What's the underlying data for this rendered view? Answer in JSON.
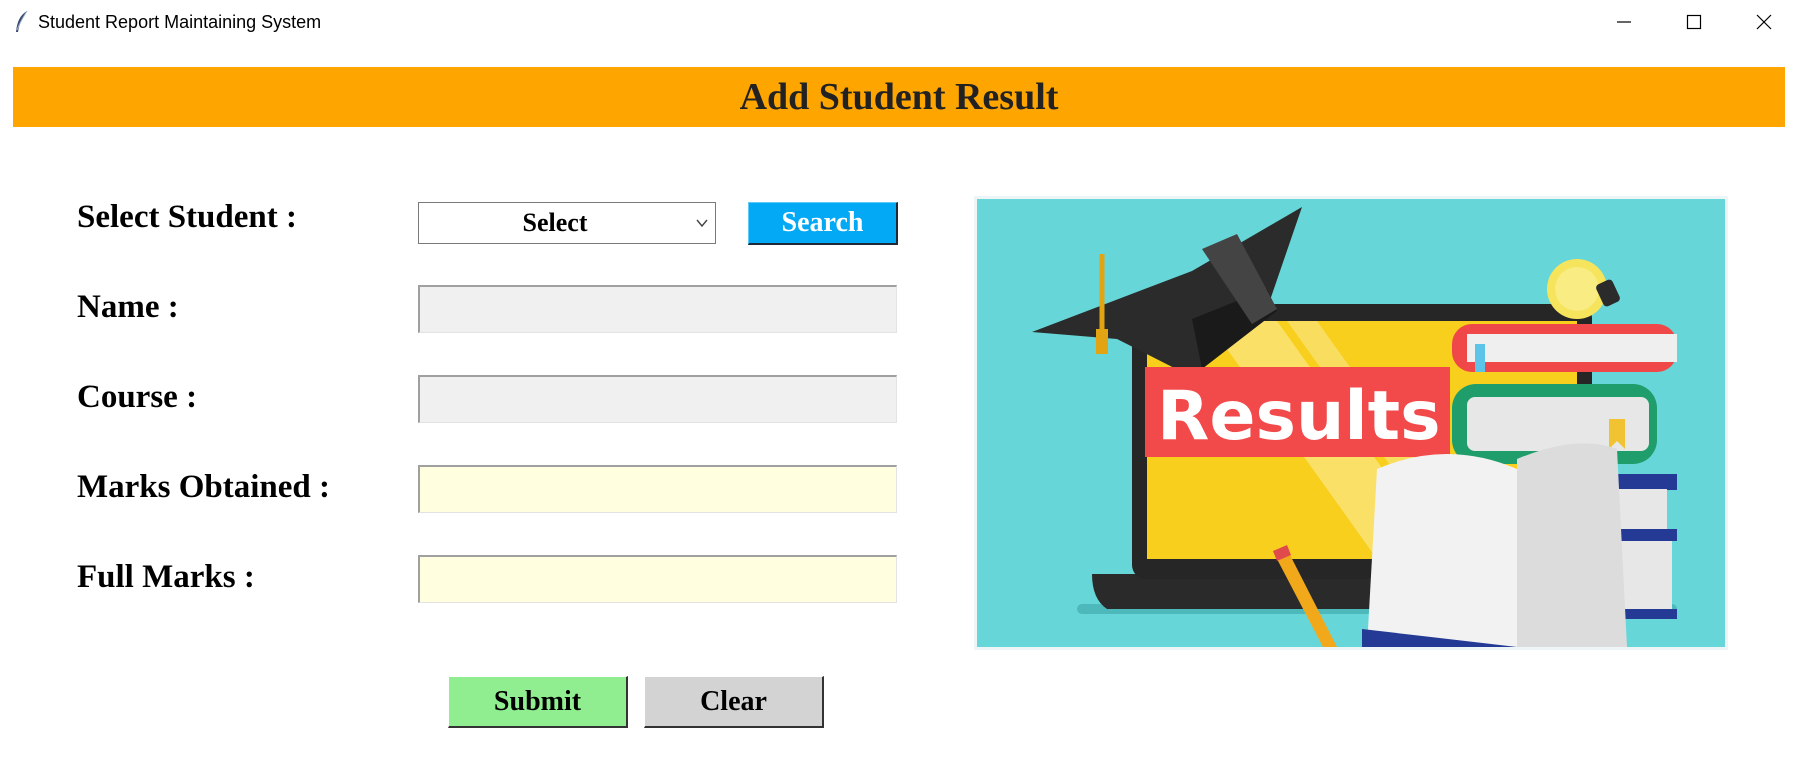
{
  "window": {
    "title": "Student Report Maintaining System",
    "icon": "feather-icon"
  },
  "header": {
    "title": "Add Student Result",
    "background": "#ffa500"
  },
  "form": {
    "select_student_label": "Select Student :",
    "select_student_value": "Select",
    "search_button_label": "Search",
    "name_label": "Name :",
    "name_value": "",
    "course_label": "Course :",
    "course_value": "",
    "marks_obtained_label": "Marks Obtained :",
    "marks_obtained_value": "",
    "full_marks_label": "Full Marks :",
    "full_marks_value": ""
  },
  "image": {
    "text": "Results"
  },
  "actions": {
    "submit_label": "Submit",
    "clear_label": "Clear"
  },
  "colors": {
    "search_button": "#03a9f4",
    "submit_button": "#90ee90",
    "clear_button": "#d3d3d3",
    "readonly_field": "#f0f0f0",
    "editable_field": "#ffffe0",
    "image_background": "#67d6d8"
  }
}
